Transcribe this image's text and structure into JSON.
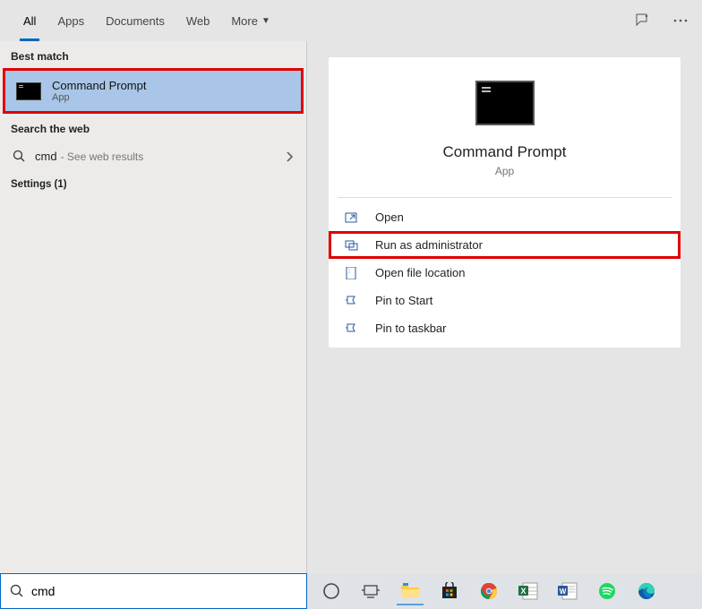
{
  "tabs": {
    "all": "All",
    "apps": "Apps",
    "documents": "Documents",
    "web": "Web",
    "more": "More"
  },
  "sections": {
    "best_match": "Best match",
    "search_web": "Search the web",
    "settings": "Settings (1)"
  },
  "best": {
    "title": "Command Prompt",
    "subtitle": "App"
  },
  "web": {
    "term": "cmd",
    "hint": " - See web results"
  },
  "preview": {
    "title": "Command Prompt",
    "subtitle": "App"
  },
  "actions": {
    "open": "Open",
    "run_admin": "Run as administrator",
    "open_loc": "Open file location",
    "pin_start": "Pin to Start",
    "pin_task": "Pin to taskbar"
  },
  "search": {
    "value": "cmd"
  }
}
